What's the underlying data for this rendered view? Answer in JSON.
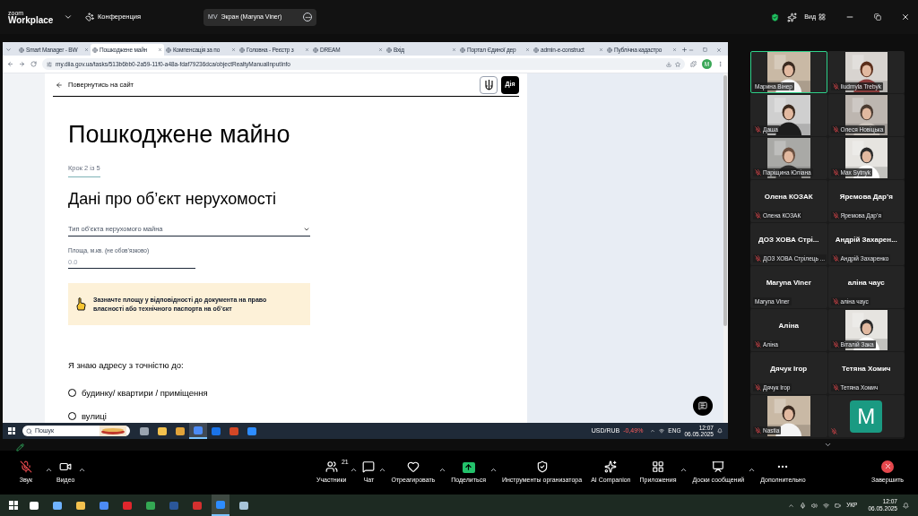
{
  "zoom_bar": {
    "brand": "zoom",
    "product": "Workplace",
    "meeting": "Конференция",
    "share_initials": "MV",
    "share_label": "Экран (Maryna Viner)",
    "view": "Вид"
  },
  "browser": {
    "tabs": [
      {
        "title": "Smart Manager - BW",
        "selected": false
      },
      {
        "title": "Пошкоджене майн",
        "selected": true
      },
      {
        "title": "Компенсація за по",
        "selected": false
      },
      {
        "title": "Головна - Реєстр з",
        "selected": false
      },
      {
        "title": "DREAM",
        "selected": false
      },
      {
        "title": "Вхід",
        "selected": false
      },
      {
        "title": "Портал Єдиної дер",
        "selected": false
      },
      {
        "title": "admin-e-construct",
        "selected": false
      },
      {
        "title": "Публічна кадастро",
        "selected": false
      }
    ],
    "url": "my.diia.gov.ua/tasks/513b6bb0-2a59-11f0-a48a-fdaf79236dca/objectRealtyManualInputInfo",
    "profile": "M"
  },
  "page": {
    "back": "Повернутись на сайт",
    "brand": "Дія",
    "title": "Пошкоджене майно",
    "step": "Крок 2 із 5",
    "section": "Дані про об’єкт нерухомості",
    "select_placeholder": "Тип об’єкта нерухомого майна",
    "area_label": "Площа, м.кв. (не обов’язково)",
    "area_placeholder": "0.0",
    "notice": "Зазначте площу у відповідності до документа на право власності або технічного паспорта на об’єкт",
    "question": "Я знаю адресу з точністю до:",
    "options": [
      {
        "label": "будинку/ квартири / приміщення",
        "selected": false
      },
      {
        "label": "вулиці",
        "selected": false
      }
    ]
  },
  "remote_taskbar": {
    "search": "Пошук",
    "apps": [
      {
        "active": false
      },
      {
        "active": false
      },
      {
        "active": false
      },
      {
        "active": true
      },
      {
        "active": false
      },
      {
        "active": false
      },
      {
        "active": false
      }
    ],
    "ticker": "USD/RUB",
    "change": "-0,49%",
    "lang": "ENG",
    "time": "12:07",
    "date": "06.05.2025"
  },
  "participants": [
    {
      "kind": "video",
      "label": "Марина Вінер",
      "muted": false,
      "active": true
    },
    {
      "kind": "video",
      "label": "Iiudmyla Trebyk",
      "muted": true,
      "active": false
    },
    {
      "kind": "video",
      "label": "Даша",
      "muted": true,
      "active": false
    },
    {
      "kind": "video",
      "label": "Олеся Новіцька",
      "muted": true,
      "active": false
    },
    {
      "kind": "video",
      "label": "Паріщина Юліана",
      "muted": true,
      "active": false
    },
    {
      "kind": "video",
      "label": "Max Sytnyk",
      "muted": true,
      "active": false
    },
    {
      "kind": "name",
      "display": "Олена КОЗАК",
      "label": "Олена КОЗАК",
      "muted": true,
      "active": false
    },
    {
      "kind": "name",
      "display": "Яремова Дар’я",
      "label": "Яремова Дар’я",
      "muted": true,
      "active": false
    },
    {
      "kind": "name",
      "display": "ДОЗ ХОВА Стрі...",
      "label": "ДОЗ ХОВА Стрілець ...",
      "muted": true,
      "active": false
    },
    {
      "kind": "name",
      "display": "Андрій Захарен...",
      "label": "Андрій Захаренко",
      "muted": true,
      "active": false
    },
    {
      "kind": "name",
      "display": "Maryna Viner",
      "label": "Maryna Viner",
      "muted": false,
      "active": false
    },
    {
      "kind": "name",
      "display": "аліна чаус",
      "label": "аліна чаус",
      "muted": true,
      "active": false
    },
    {
      "kind": "name",
      "display": "Аліна",
      "label": "Аліна",
      "muted": true,
      "active": false
    },
    {
      "kind": "video",
      "label": "Віталій Зака",
      "muted": true,
      "active": false
    },
    {
      "kind": "name",
      "display": "Дячук Ігор",
      "label": "Дячук Ігор",
      "muted": true,
      "active": false
    },
    {
      "kind": "name",
      "display": "Тетяна Хомич",
      "label": "Тетяна Хомич",
      "muted": true,
      "active": false
    },
    {
      "kind": "video",
      "label": "Nastia",
      "muted": true,
      "active": false
    },
    {
      "kind": "letter",
      "letter": "M",
      "muted": true,
      "active": false
    }
  ],
  "toolbar": {
    "audio": {
      "label": "Звук",
      "muted": true
    },
    "items": [
      {
        "kind": "plain",
        "label": "Видео",
        "caret": true
      },
      {
        "kind": "plain",
        "label": "Участники",
        "count": "21",
        "caret": true
      },
      {
        "kind": "plain",
        "label": "Чат",
        "caret": true
      },
      {
        "kind": "plain",
        "label": "Отреагировать",
        "caret": true
      },
      {
        "kind": "share",
        "label": "Поделиться",
        "caret": true
      },
      {
        "kind": "plain",
        "label": "Инструменты организатора",
        "caret": false
      },
      {
        "kind": "plain",
        "label": "AI Companion",
        "caret": false
      },
      {
        "kind": "plain",
        "label": "Приложения",
        "caret": true
      },
      {
        "kind": "plain",
        "label": "Доски сообщений",
        "caret": true
      },
      {
        "kind": "plain",
        "label": "Дополнительно",
        "caret": false
      }
    ],
    "end": "Завершить"
  },
  "taskbar": {
    "apps": [
      {
        "active": false
      },
      {
        "active": false
      },
      {
        "active": false
      },
      {
        "active": false
      },
      {
        "active": false
      },
      {
        "active": false
      },
      {
        "active": false
      },
      {
        "active": false
      },
      {
        "active": true
      },
      {
        "active": false
      }
    ],
    "lang": "УКР",
    "time": "12:07",
    "date": "06.05.2025"
  }
}
